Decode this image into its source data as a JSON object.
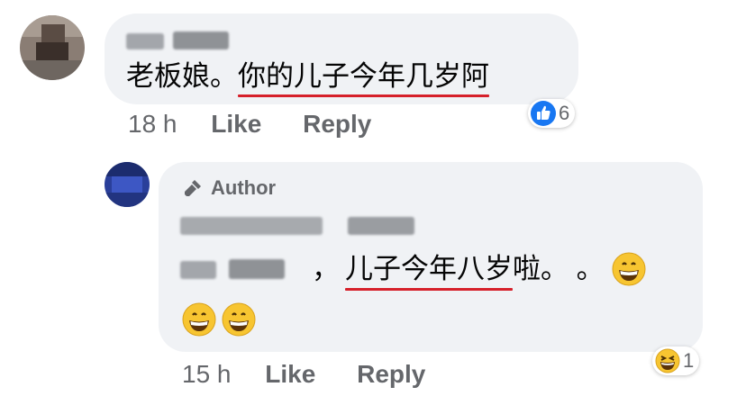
{
  "comment": {
    "text_prefix": "老板娘。",
    "text_highlight": "你的儿子今年几岁阿",
    "time": "18 h",
    "like_label": "Like",
    "reply_label": "Reply",
    "reaction_icon": "like-icon",
    "reaction_count": "6"
  },
  "reply": {
    "badge_label": "Author",
    "badge_icon": "microphone-icon",
    "text_prefix": "，",
    "text_highlight": "儿子今年八岁",
    "text_suffix": "啦。 。",
    "time": "15 h",
    "like_label": "Like",
    "reply_label": "Reply",
    "reaction_icon": "laughing-emoji-icon",
    "reaction_count": "1"
  },
  "colors": {
    "bubble": "#f0f2f5",
    "meta": "#65676b",
    "underline": "#d6202a",
    "like_blue": "#1877f2"
  }
}
